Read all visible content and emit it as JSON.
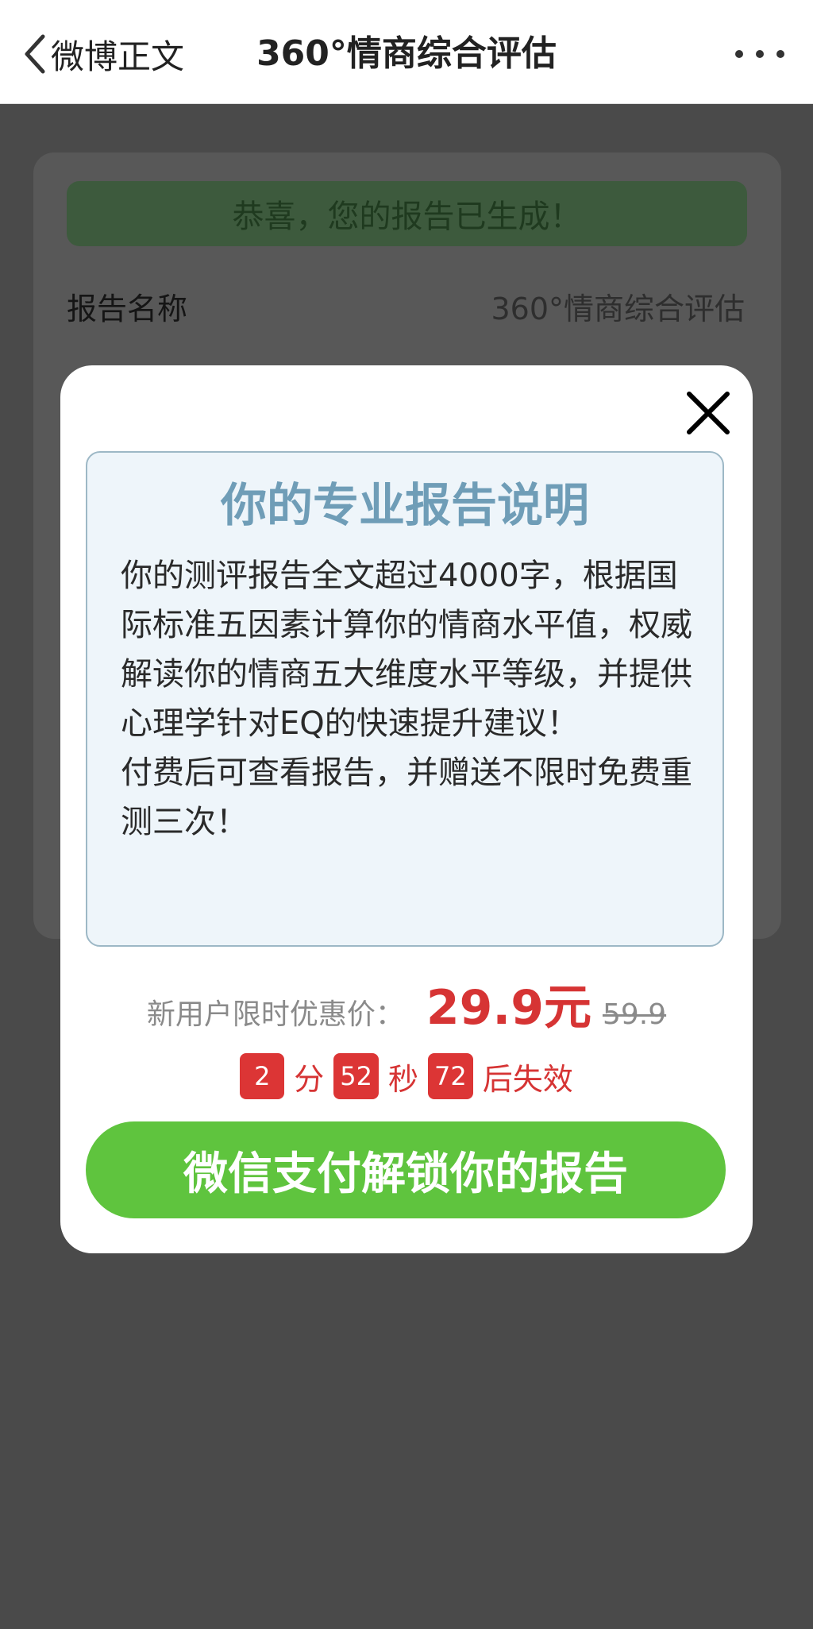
{
  "navbar": {
    "back_label": "微博正文",
    "title": "360°情商综合评估",
    "more_icon": "more-dots-icon"
  },
  "background": {
    "banner_text": "恭喜，您的报告已生成！",
    "row_label": "报告名称",
    "row_value": "360°情商综合评估"
  },
  "modal": {
    "close_icon": "close-icon",
    "info_title": "你的专业报告说明",
    "info_paragraphs": [
      "你的测评报告全文超过4000字，根据国际标准五因素计算你的情商水平值，权威解读你的情商五大维度水平等级，并提供心理学针对EQ的快速提升建议！",
      "付费后可查看报告，并赠送不限时免费重测三次！"
    ],
    "price_label": "新用户限时优惠价：",
    "price_now": "29.9元",
    "price_old": "59.9",
    "countdown": {
      "minutes": "2",
      "minutes_unit": "分",
      "seconds": "52",
      "seconds_unit": "秒",
      "ms": "72",
      "suffix": "后失效"
    },
    "pay_button": "微信支付解锁你的报告"
  },
  "colors": {
    "accent_green": "#5fc43e",
    "price_red": "#d63434",
    "title_blue": "#6f9db7",
    "overlay": "#4a4a4a"
  }
}
